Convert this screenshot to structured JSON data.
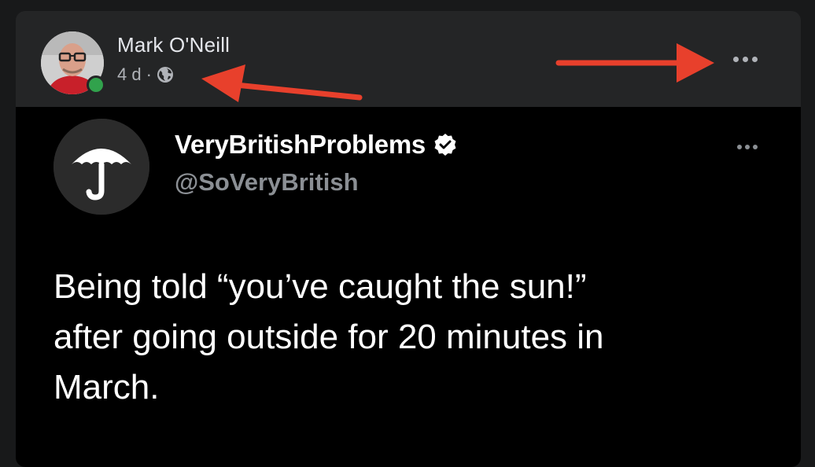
{
  "post": {
    "author": "Mark O'Neill",
    "timestamp": "4 d",
    "separator": "·",
    "privacy_icon": "globe-icon",
    "more_icon": "more-horizontal-icon",
    "presence_status": "online"
  },
  "tweet": {
    "name": "VeryBritishProblems",
    "verified_icon": "verified-badge-icon",
    "handle": "@SoVeryBritish",
    "avatar_icon": "umbrella-icon",
    "text": "Being told “you’ve caught the sun!”\nafter going outside for 20 minutes in\nMarch."
  },
  "annotations": {
    "arrow_color": "#e8402c",
    "arrows": [
      "arrow-to-timestamp",
      "arrow-to-more-options"
    ]
  },
  "colors": {
    "background": "#18191a",
    "card": "#242526",
    "text_primary": "#e4e6eb",
    "text_secondary": "#b0b3b8",
    "presence": "#31a24c",
    "tweet_bg": "#000000"
  }
}
